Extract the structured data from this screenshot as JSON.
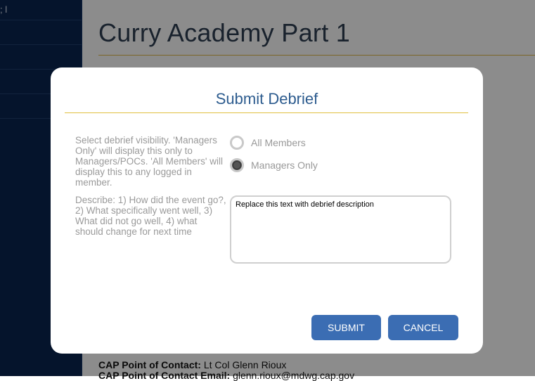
{
  "sidebar": {
    "items": [
      {
        "label": "; l"
      },
      {
        "label": ""
      },
      {
        "label": ""
      },
      {
        "label": ""
      },
      {
        "label": ""
      }
    ]
  },
  "page": {
    "title": "Curry Academy Part 1",
    "poc_label": "CAP Point of Contact:",
    "poc_value": " Lt Col Glenn Rioux",
    "email_label": "CAP Point of Contact Email:",
    "email_value": " glenn.rioux@mdwg.cap.gov"
  },
  "modal": {
    "title": "Submit Debrief",
    "visibility_help": "Select debrief visibility. 'Managers Only' will display this only to Managers/POCs. 'All Members' will display this to any logged in member.",
    "describe_help": "Describe: 1) How did the event go?, 2) What specifically went well, 3) What did not go well, 4) what should change for next time",
    "options": [
      {
        "label": "All Members",
        "checked": false
      },
      {
        "label": "Managers Only",
        "checked": true
      }
    ],
    "description_value": "Replace this text with debrief description",
    "submit_label": "SUBMIT",
    "cancel_label": "CANCEL"
  },
  "colors": {
    "sidebar": "#0a2550",
    "accent": "#3b6db3",
    "title": "#2c5b8e",
    "rule": "#e0c040"
  }
}
